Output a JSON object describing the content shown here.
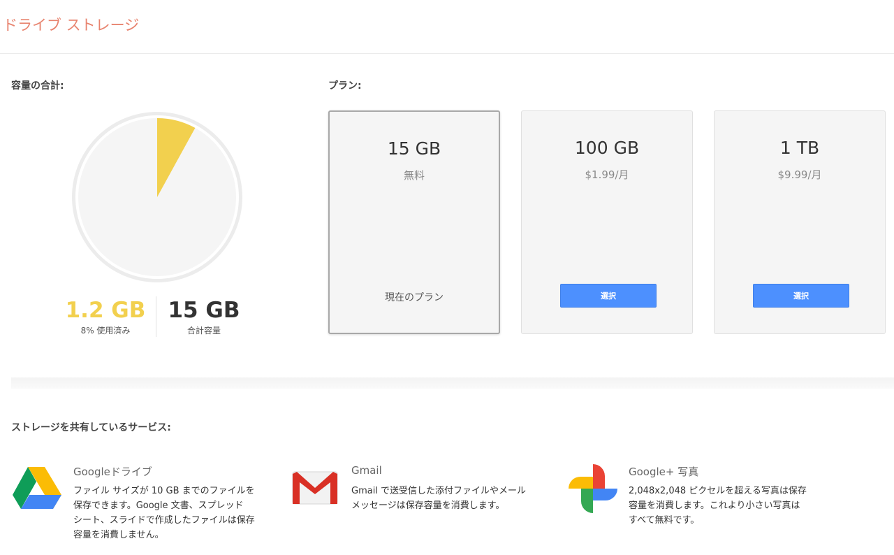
{
  "header": {
    "title": "ドライブ ストレージ"
  },
  "usage": {
    "label": "容量の合計:",
    "used": "1.2 GB",
    "used_caption": "8% 使用済み",
    "used_fraction": 0.08,
    "total": "15 GB",
    "total_caption": "合計容量"
  },
  "plans": {
    "label": "プラン:",
    "items": [
      {
        "size": "15 GB",
        "price": "無料",
        "status": "現在のプラン"
      },
      {
        "size": "100 GB",
        "price": "$1.99/月",
        "button": "選択"
      },
      {
        "size": "1 TB",
        "price": "$9.99/月",
        "button": "選択"
      }
    ]
  },
  "services": {
    "label": "ストレージを共有しているサービス:",
    "items": [
      {
        "name": "Googleドライブ",
        "icon": "google-drive-icon",
        "desc": [
          "ファイル サイズが 10 GB までのファイルを",
          "保存できます。Google 文書、スプレッド",
          "シート、スライドで作成したファイルは保存",
          "容量を消費しません。"
        ]
      },
      {
        "name": "Gmail",
        "icon": "gmail-icon",
        "desc": [
          "Gmail で送受信した添付ファイルやメール",
          "メッセージは保存容量を消費します。"
        ]
      },
      {
        "name": "Google+ 写真",
        "icon": "google-photos-icon",
        "desc": [
          "2,048x2,048 ピクセルを超える写真は保存",
          "容量を消費します。これより小さい写真は",
          "すべて無料です。"
        ]
      }
    ]
  },
  "colors": {
    "title": "#e8836e",
    "usage_accent": "#f2d04e",
    "button": "#4d90fe"
  }
}
